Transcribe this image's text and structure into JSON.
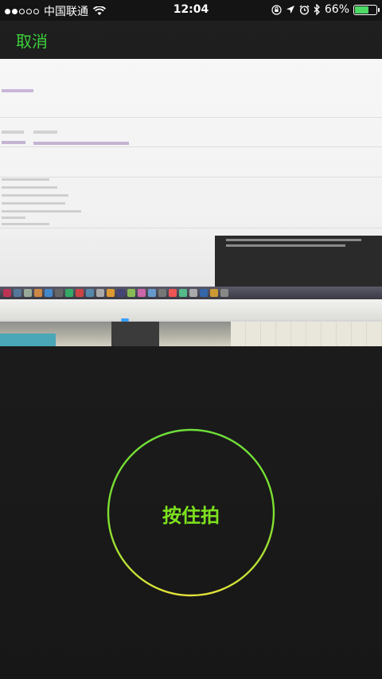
{
  "status_bar": {
    "carrier": "中国联通",
    "time": "12:04",
    "battery_percent": "66%",
    "battery_level": 0.66,
    "icons": [
      "signal-dots-icon",
      "wifi-icon",
      "rotation-lock-icon",
      "location-icon",
      "alarm-icon",
      "bluetooth-icon",
      "battery-icon"
    ]
  },
  "nav": {
    "cancel_label": "取消"
  },
  "record": {
    "label": "按住拍"
  },
  "colors": {
    "accent_green": "#3bd13b",
    "record_text": "#7ee21f",
    "ring_top": "#6fe03a",
    "ring_bottom": "#e4e23a",
    "background": "#1d1d1d"
  }
}
